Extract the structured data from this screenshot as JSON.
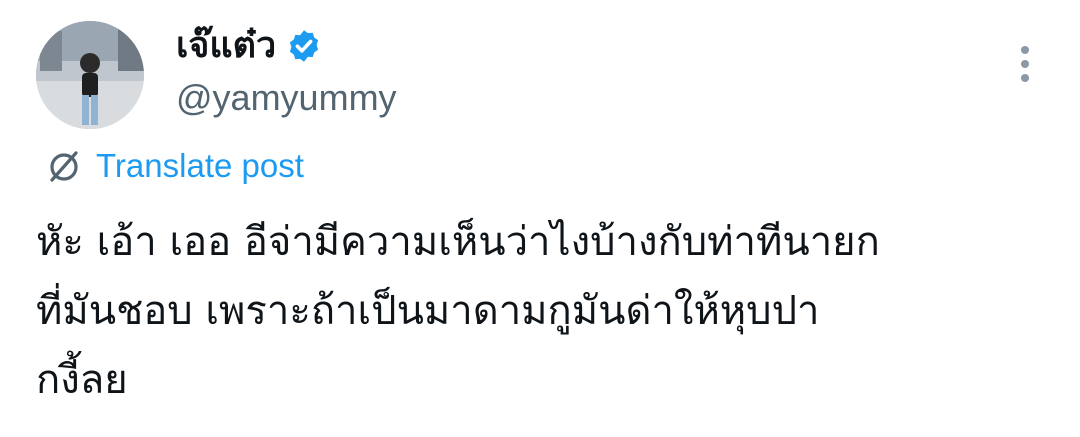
{
  "author": {
    "display_name": "เจ๊แต๋ว",
    "handle": "@yamyummy",
    "verified": true
  },
  "actions": {
    "more_icon": "more-vertical-icon",
    "translate_label": "Translate post",
    "translate_icon": "translate-globe-icon"
  },
  "tweet": {
    "text": "หัะ เอ้า เออ อีจ่ามีความเห็นว่าไงบ้างกับท่าทีนายก\nที่มันชอบ เพราะถ้าเป็นมาดามกูมันด่าให้หุบปา\nกงี้ลย"
  },
  "colors": {
    "accent": "#1d9bf0",
    "secondary_text": "#536471",
    "primary_text": "#0f1419"
  }
}
